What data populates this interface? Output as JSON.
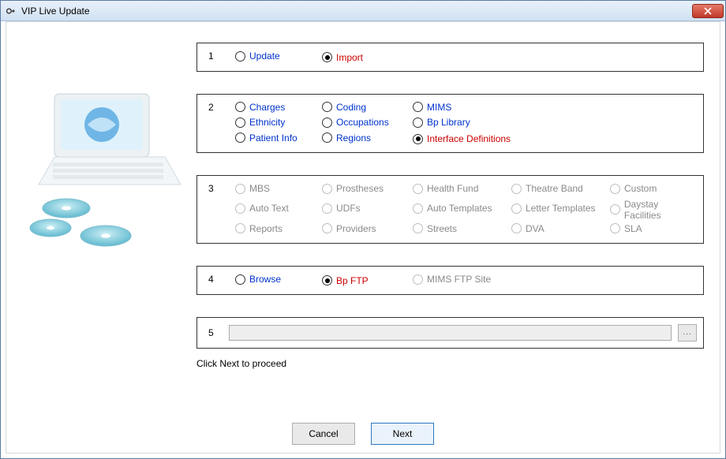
{
  "window": {
    "title": "VIP Live Update"
  },
  "steps": {
    "s1": {
      "num": "1",
      "update": "Update",
      "import": "Import"
    },
    "s2": {
      "num": "2",
      "charges": "Charges",
      "coding": "Coding",
      "mims": "MIMS",
      "ethnicity": "Ethnicity",
      "occupations": "Occupations",
      "bplibrary": "Bp Library",
      "patientinfo": "Patient Info",
      "regions": "Regions",
      "interfacedefs": "Interface Definitions"
    },
    "s3": {
      "num": "3",
      "mbs": "MBS",
      "prostheses": "Prostheses",
      "healthfund": "Health Fund",
      "theatreband": "Theatre Band",
      "custom": "Custom",
      "autotext": "Auto Text",
      "udfs": "UDFs",
      "autotemplates": "Auto Templates",
      "lettertemplates": "Letter Templates",
      "daystay": "Daystay Facilities",
      "reports": "Reports",
      "providers": "Providers",
      "streets": "Streets",
      "dva": "DVA",
      "sla": "SLA"
    },
    "s4": {
      "num": "4",
      "browse": "Browse",
      "bpftp": "Bp FTP",
      "mimsftp": "MIMS FTP Site"
    },
    "s5": {
      "num": "5",
      "browse_label": "..."
    }
  },
  "hint": "Click Next to proceed",
  "buttons": {
    "cancel": "Cancel",
    "next": "Next"
  }
}
